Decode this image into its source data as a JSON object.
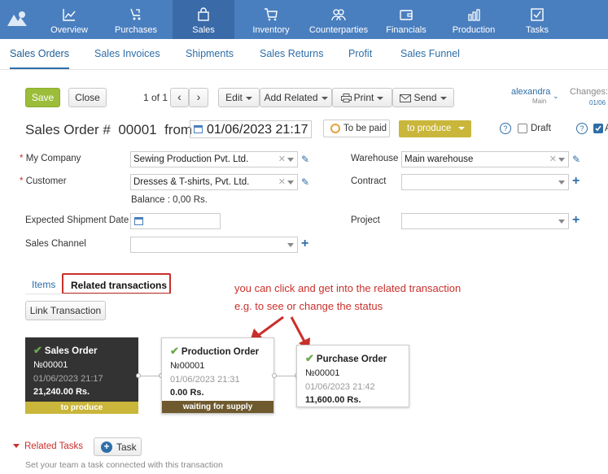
{
  "nav": {
    "items": [
      {
        "label": "Overview",
        "icon": "chart-line-icon"
      },
      {
        "label": "Purchases",
        "icon": "purchases-icon"
      },
      {
        "label": "Sales",
        "icon": "shopping-bag-icon"
      },
      {
        "label": "Inventory",
        "icon": "cart-icon"
      },
      {
        "label": "Counterparties",
        "icon": "people-icon"
      },
      {
        "label": "Financials",
        "icon": "wallet-icon"
      },
      {
        "label": "Production",
        "icon": "bar-chart-icon"
      },
      {
        "label": "Tasks",
        "icon": "checkbox-icon"
      }
    ],
    "active": "Sales"
  },
  "subnav": {
    "tabs": [
      "Sales Orders",
      "Sales Invoices",
      "Shipments",
      "Sales Returns",
      "Profit",
      "Sales Funnel"
    ],
    "active": "Sales Orders"
  },
  "toolbar": {
    "save": "Save",
    "close": "Close",
    "pager": "1 of 1",
    "edit": "Edit",
    "add_related": "Add Related",
    "print": "Print",
    "send": "Send",
    "user": "alexandra",
    "user_sub": "Main",
    "changes": "Changes:",
    "changes_sub": "01/06"
  },
  "header": {
    "title_prefix": "Sales Order #",
    "number": "00001",
    "from": "from",
    "date": "01/06/2023 21:17",
    "status": "To be paid",
    "produce": "to produce",
    "draft": "Draft",
    "trailing": "A"
  },
  "form": {
    "my_company_label": "My Company",
    "my_company": "Sewing Production Pvt. Ltd.",
    "customer_label": "Customer",
    "customer": "Dresses & T-shirts, Pvt. Ltd.",
    "balance": "Balance : 0,00 Rs.",
    "shipment_label": "Expected Shipment Date",
    "channel_label": "Sales Channel",
    "warehouse_label": "Warehouse",
    "warehouse": "Main warehouse",
    "contract_label": "Contract",
    "project_label": "Project"
  },
  "tabs": {
    "items": "Items",
    "related": "Related transactions"
  },
  "link_transaction": "Link Transaction",
  "annotation": {
    "line1": "you can click and get into the related transaction",
    "line2": "e.g. to see or change the status"
  },
  "cards": [
    {
      "title": "Sales Order",
      "number": "№00001",
      "date": "01/06/2023 21:17",
      "amount": "21,240.00 Rs.",
      "status": "to produce"
    },
    {
      "title": "Production Order",
      "number": "№00001",
      "date": "01/06/2023 21:31",
      "amount": "0.00 Rs.",
      "status": "waiting for supply"
    },
    {
      "title": "Purchase Order",
      "number": "№00001",
      "date": "01/06/2023 21:42",
      "amount": "11,600.00 Rs."
    }
  ],
  "related_tasks": {
    "label": "Related Tasks",
    "button": "Task",
    "hint": "Set your team a task connected with this transaction"
  },
  "colors": {
    "nav_bg": "#4a7fbf",
    "accent": "#2e6ea8",
    "save": "#9bbd3a",
    "produce": "#c9b63a",
    "highlight": "#c9302c"
  }
}
